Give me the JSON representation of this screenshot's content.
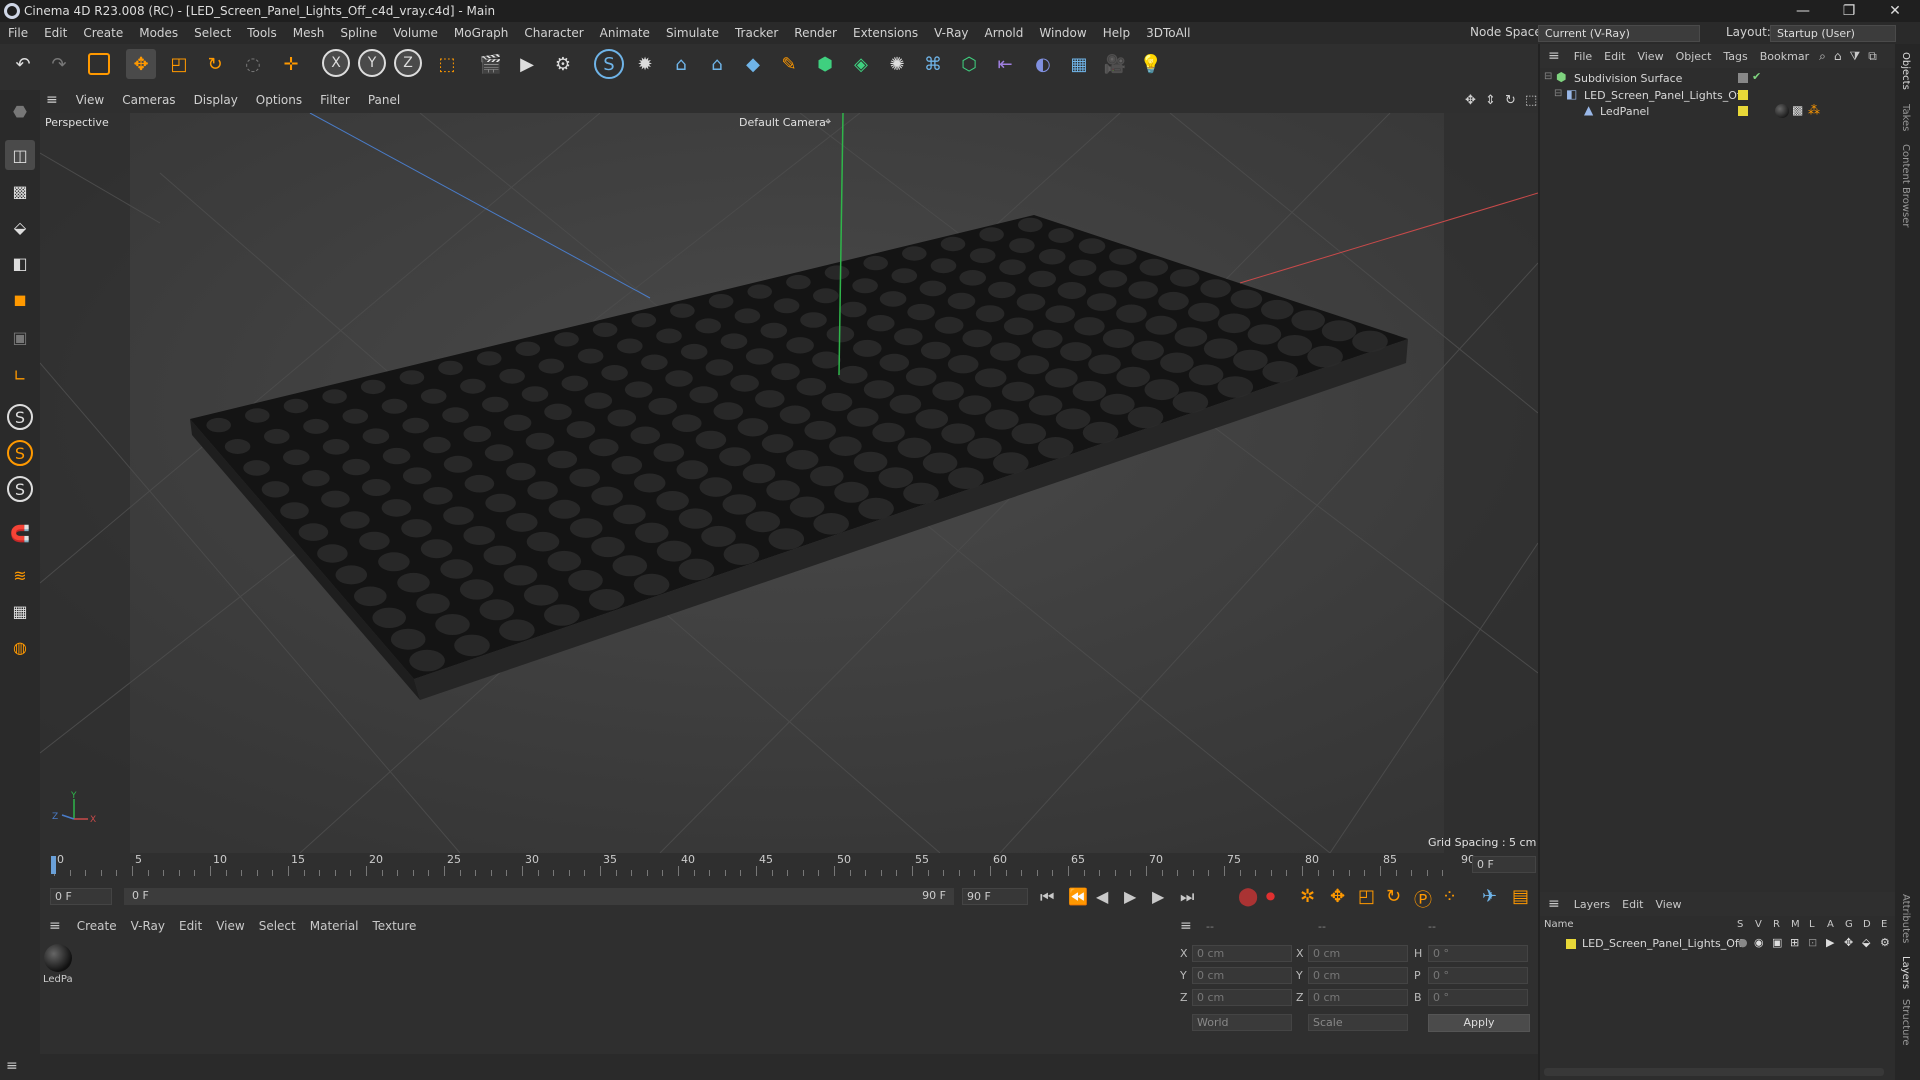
{
  "window": {
    "title": "Cinema 4D R23.008 (RC) - [LED_Screen_Panel_Lights_Off_c4d_vray.c4d] - Main"
  },
  "menu": [
    "File",
    "Edit",
    "Create",
    "Modes",
    "Select",
    "Tools",
    "Mesh",
    "Spline",
    "Volume",
    "MoGraph",
    "Character",
    "Animate",
    "Simulate",
    "Tracker",
    "Render",
    "Extensions",
    "V-Ray",
    "Arnold",
    "Window",
    "Help",
    "3DToAll"
  ],
  "header_right": {
    "node_space_label": "Node Space:",
    "node_space_value": "Current (V-Ray)",
    "layout_label": "Layout:",
    "layout_value": "Startup (User)"
  },
  "viewport_menu": [
    "View",
    "Cameras",
    "Display",
    "Options",
    "Filter",
    "Panel"
  ],
  "viewport": {
    "name": "Perspective",
    "camera": "Default Camera",
    "grid_spacing": "Grid Spacing : 5 cm"
  },
  "timeline": {
    "ticks": [
      "0",
      "5",
      "10",
      "15",
      "20",
      "25",
      "30",
      "35",
      "40",
      "45",
      "50",
      "55",
      "60",
      "65",
      "70",
      "75",
      "80",
      "85",
      "90"
    ],
    "current_frame": "0 F"
  },
  "transport": {
    "start": "0 F",
    "range_start": "0 F",
    "range_end": "90 F",
    "end": "90 F"
  },
  "material_menu": [
    "Create",
    "V-Ray",
    "Edit",
    "View",
    "Select",
    "Material",
    "Texture"
  ],
  "material": {
    "name": "LedPa"
  },
  "coords": {
    "header": [
      "--",
      "--",
      "--"
    ],
    "rows": [
      {
        "a": "X",
        "av": "0 cm",
        "b": "X",
        "bv": "0 cm",
        "c": "H",
        "cv": "0 °"
      },
      {
        "a": "Y",
        "av": "0 cm",
        "b": "Y",
        "bv": "0 cm",
        "c": "P",
        "cv": "0 °"
      },
      {
        "a": "Z",
        "av": "0 cm",
        "b": "Z",
        "bv": "0 cm",
        "c": "B",
        "cv": "0 °"
      }
    ],
    "space": "World",
    "mode": "Scale",
    "apply": "Apply"
  },
  "objects_menu": [
    "File",
    "Edit",
    "View",
    "Object",
    "Tags",
    "Bookmar"
  ],
  "objects": [
    {
      "name": "Subdivision Surface",
      "color": "#7fd47f"
    },
    {
      "name": "LED_Screen_Panel_Lights_Off",
      "color": "#e8d838"
    },
    {
      "name": "LedPanel",
      "color": "#e8d838"
    }
  ],
  "layers_menu": [
    "Layers",
    "Edit",
    "View"
  ],
  "layers": {
    "name_col": "Name",
    "cols": [
      "S",
      "V",
      "R",
      "M",
      "L",
      "A",
      "G",
      "D",
      "E"
    ],
    "row": "LED_Screen_Panel_Lights_Off"
  },
  "side_tabs": [
    "Objects",
    "Takes",
    "Content Browser",
    "Attributes",
    "Layers",
    "Structure"
  ],
  "colors": {
    "accent": "#ff9900",
    "axis_x": "#c84a4a",
    "axis_y": "#2fb54a",
    "axis_z": "#4a7cc8"
  }
}
